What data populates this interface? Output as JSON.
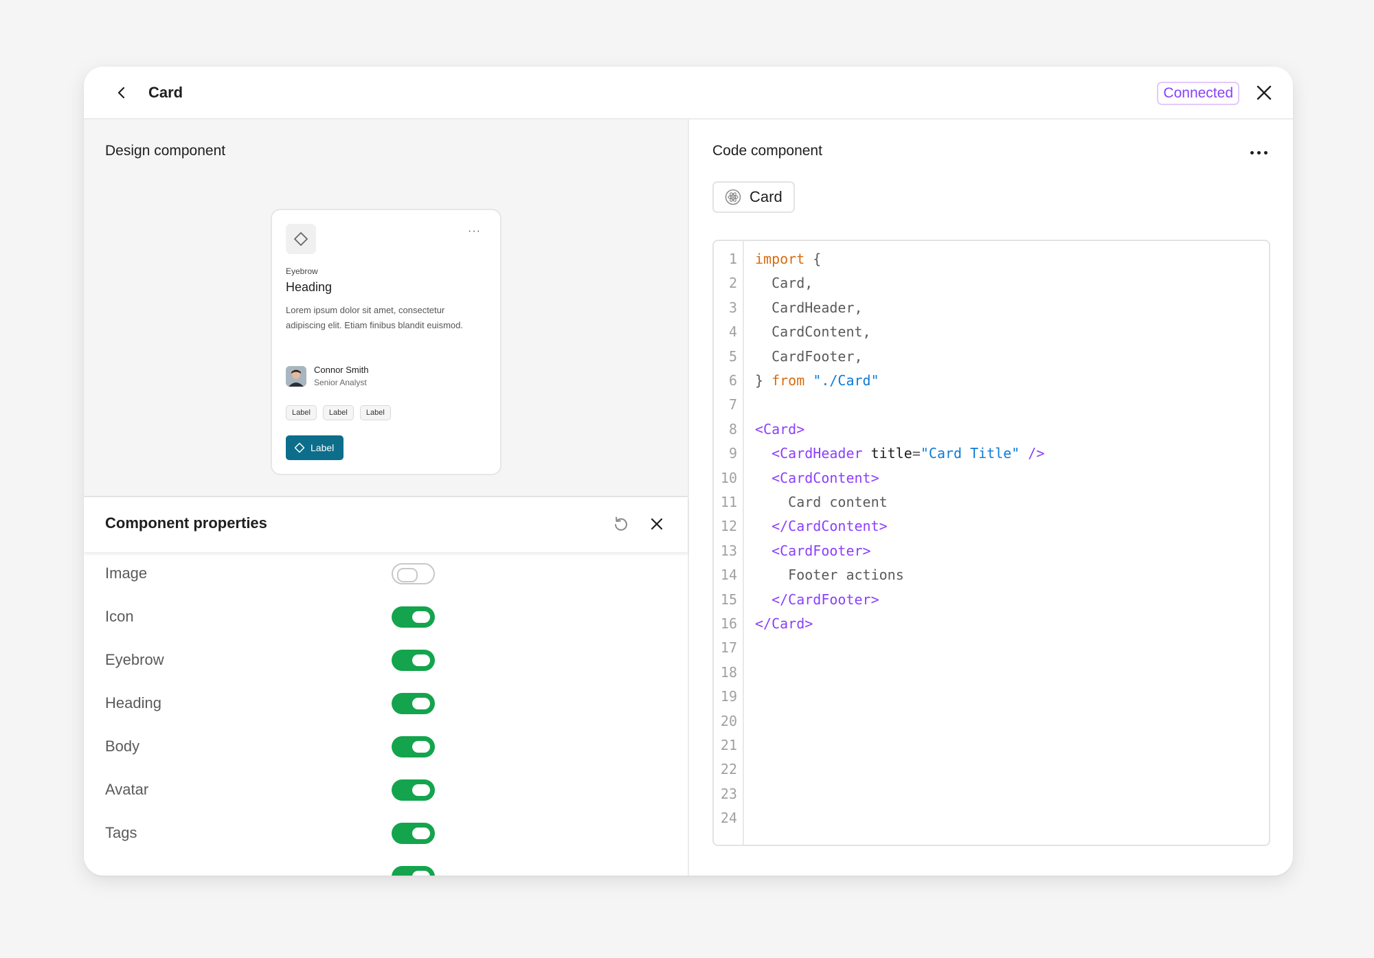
{
  "window": {
    "title": "Card",
    "status": "Connected",
    "colors": {
      "accent": "#8a3ffc",
      "toggle_on": "#14a44d",
      "primary_button": "#0c6e8a"
    }
  },
  "design": {
    "section_title": "Design component",
    "preview": {
      "eyebrow": "Eyebrow",
      "heading": "Heading",
      "body": "Lorem ipsum dolor sit amet, consectetur adipiscing elit. Etiam finibus blandit euismod.",
      "author_name": "Connor Smith",
      "author_role": "Senior Analyst",
      "tags": [
        "Label",
        "Label",
        "Label"
      ],
      "button_label": "Label"
    }
  },
  "properties": {
    "title": "Component properties",
    "items": [
      {
        "label": "Image",
        "enabled": false
      },
      {
        "label": "Icon",
        "enabled": true
      },
      {
        "label": "Eyebrow",
        "enabled": true
      },
      {
        "label": "Heading",
        "enabled": true
      },
      {
        "label": "Body",
        "enabled": true
      },
      {
        "label": "Avatar",
        "enabled": true
      },
      {
        "label": "Tags",
        "enabled": true
      }
    ]
  },
  "code": {
    "section_title": "Code component",
    "component_name": "Card",
    "line_count": 24,
    "lines": [
      [
        [
          "kw",
          "import"
        ],
        [
          "punct",
          " {"
        ]
      ],
      [
        [
          "punct",
          "  Card,"
        ]
      ],
      [
        [
          "punct",
          "  CardHeader,"
        ]
      ],
      [
        [
          "punct",
          "  CardContent,"
        ]
      ],
      [
        [
          "punct",
          "  CardFooter,"
        ]
      ],
      [
        [
          "punct",
          "} "
        ],
        [
          "kw",
          "from"
        ],
        [
          "punct",
          " "
        ],
        [
          "str",
          "\"./Card\""
        ]
      ],
      [],
      [
        [
          "tag",
          "<Card>"
        ]
      ],
      [
        [
          "punct",
          "  "
        ],
        [
          "tag",
          "<CardHeader"
        ],
        [
          "punct",
          " "
        ],
        [
          "attr",
          "title"
        ],
        [
          "punct",
          "="
        ],
        [
          "str",
          "\"Card Title\""
        ],
        [
          "punct",
          " "
        ],
        [
          "tag",
          "/>"
        ]
      ],
      [
        [
          "punct",
          "  "
        ],
        [
          "tag",
          "<CardContent>"
        ]
      ],
      [
        [
          "punct",
          "    Card content"
        ]
      ],
      [
        [
          "punct",
          "  "
        ],
        [
          "tag",
          "</CardContent>"
        ]
      ],
      [
        [
          "punct",
          "  "
        ],
        [
          "tag",
          "<CardFooter>"
        ]
      ],
      [
        [
          "punct",
          "    Footer actions"
        ]
      ],
      [
        [
          "punct",
          "  "
        ],
        [
          "tag",
          "</CardFooter>"
        ]
      ],
      [
        [
          "tag",
          "</Card>"
        ]
      ]
    ]
  }
}
